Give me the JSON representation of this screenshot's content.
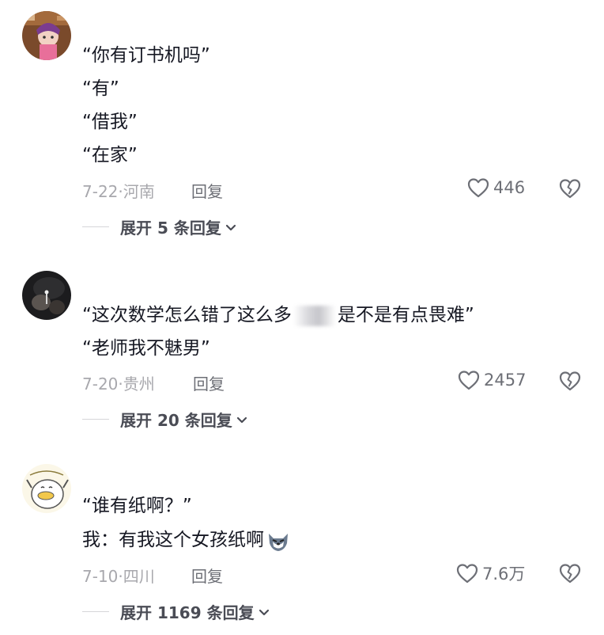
{
  "comments": [
    {
      "lines": [
        "“你有订书机吗”",
        "“有”",
        "“借我”",
        "“在家”"
      ],
      "date": "7-22",
      "location": "河南",
      "reply_label": "回复",
      "likes": "446",
      "expand_label": "展开 5 条回复",
      "avatar_icon": "cartoon-girl-avatar"
    },
    {
      "line1_before": "“这次数学怎么错了这么多",
      "line1_after": "是不是有点畏难”",
      "line2": "“老师我不魅男”",
      "date": "7-20",
      "location": "贵州",
      "reply_label": "回复",
      "likes": "2457",
      "expand_label": "展开 20 条回复",
      "avatar_icon": "dark-photo-avatar"
    },
    {
      "line1": "“谁有纸啊？”",
      "line2": "我：有我这个女孩纸啊",
      "date": "7-10",
      "location": "四川",
      "reply_label": "回复",
      "likes": "7.6万",
      "expand_label": "展开 1169 条回复",
      "avatar_icon": "white-cartoon-avatar",
      "emoji_icon": "wolf-face-emoji"
    }
  ],
  "icons": {
    "like": "heart-outline-icon",
    "dislike": "broken-heart-icon",
    "expand": "chevron-down-icon"
  }
}
